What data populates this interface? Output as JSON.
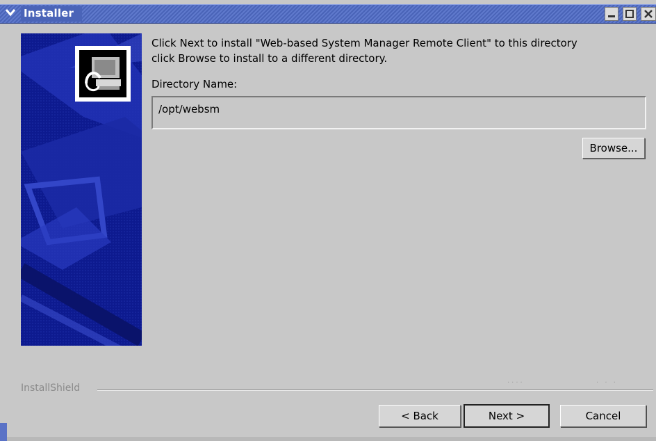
{
  "window": {
    "title": "Installer",
    "menu_icon": "chevron-down-icon",
    "controls": [
      "minimize-icon",
      "maximize-icon",
      "close-icon"
    ]
  },
  "content": {
    "instruction_line1": "Click Next to install \"Web-based System Manager Remote Client\" to this directory",
    "instruction_line2": "click Browse to install to a different directory.",
    "directory_label": "Directory Name:",
    "directory_value": "/opt/websm"
  },
  "buttons": {
    "browse": "Browse...",
    "back": "< Back",
    "next": "Next >",
    "cancel": "Cancel"
  },
  "footer": {
    "brand": "InstallShield"
  },
  "colors": {
    "titlebar": "#4a64b8",
    "side_panel": "#0d1a8f",
    "background": "#c8c8c8"
  }
}
